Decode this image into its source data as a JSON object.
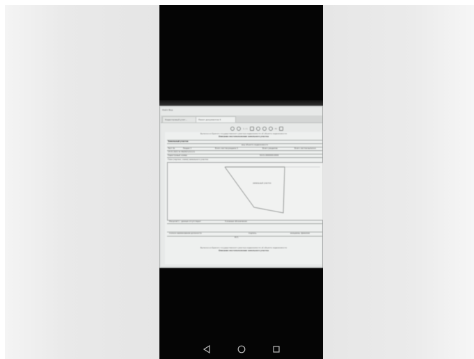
{
  "colors": {
    "phone_background": "#050505",
    "screen_paper": "#eef0ef",
    "nav_icon": "#bfbfbf"
  },
  "app": {
    "menu_text": "Файл  Вид",
    "tabs": [
      "Кадастровый учет...",
      "Пакет документов 4"
    ]
  },
  "toolbar": {
    "icons": [
      "zoom-out-icon",
      "zoom-in-icon",
      "page-icon",
      "print-icon",
      "save-icon",
      "settings-icon",
      "menu-icon"
    ],
    "page_indicator": "1 / 1",
    "zoom_label": "Ю"
  },
  "document": {
    "header_line1": "Выписка из Единого государственного реестра недвижимости об объекте недвижимости",
    "header_line2": "Описание местоположения земельного участка",
    "section_title": "Земельный участок",
    "row_subtitle": "вид объекта недвижимости",
    "sheet_label": "Лист №",
    "section_label": "Раздел 3",
    "total_sheets": "Всего листов раздела 3:",
    "total_sections": "Всего разделов:",
    "total_sheets_doc": "Всего листов выписки:",
    "date_number": "14.01.2021  №  99/2021/11111",
    "cadastral_label": "Кадастровый номер:",
    "cadastral_value": "50:01:0000000:0000",
    "plan_title": "План (чертеж, схема) земельного участка",
    "plan_parcel_label": "земельный участок",
    "scale_label": "Масштаб 1 : данные отсутствуют",
    "legend_label": "Условные обозначения:",
    "footer_label1": "полное наименование должности",
    "footer_label2": "подпись",
    "footer_label3": "инициалы, фамилия",
    "footer_mp": "М.П.",
    "footer_note1": "Выписка из Единого государственного реестра недвижимости об объекте недвижимости",
    "footer_note2": "Описание местоположения земельного участка"
  },
  "android_nav": {
    "icons": [
      "back-triangle-icon",
      "home-circle-icon",
      "recents-square-icon"
    ]
  }
}
